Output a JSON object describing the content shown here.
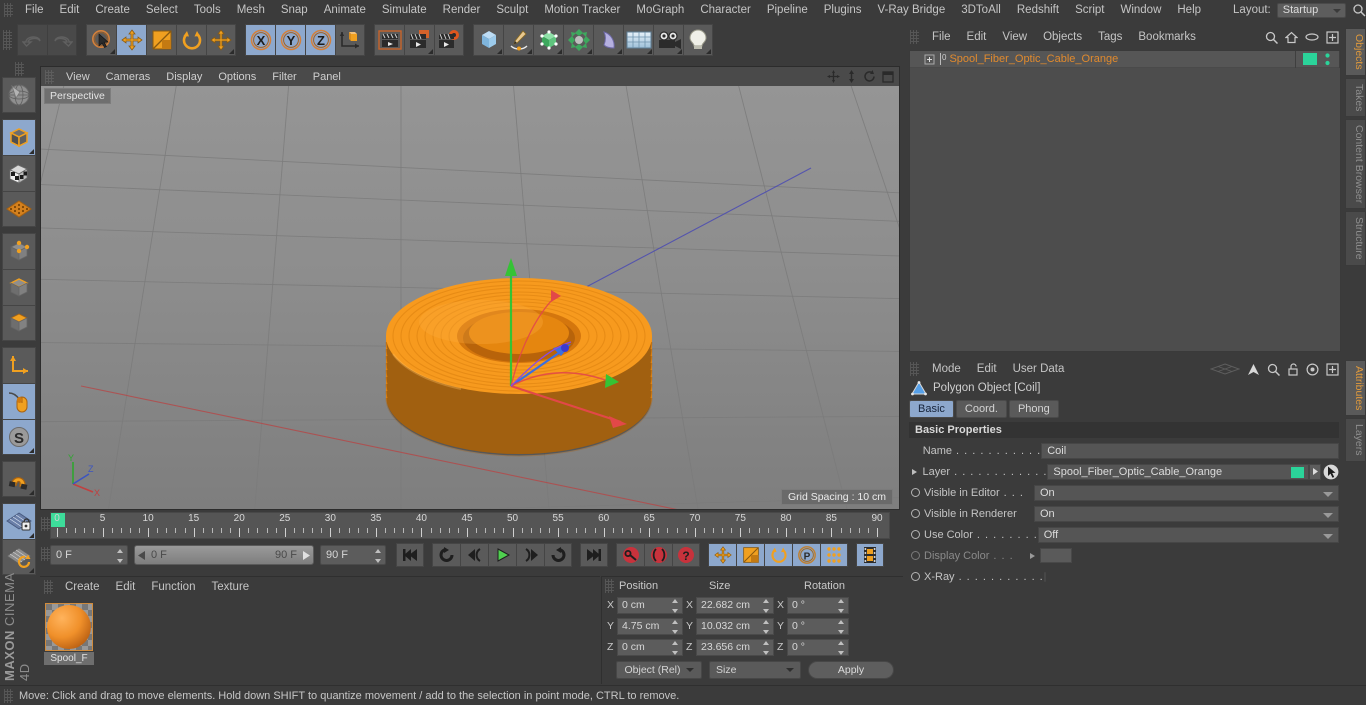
{
  "menubar": {
    "items": [
      "File",
      "Edit",
      "Create",
      "Select",
      "Tools",
      "Mesh",
      "Snap",
      "Animate",
      "Simulate",
      "Render",
      "Sculpt",
      "Motion Tracker",
      "MoGraph",
      "Character",
      "Pipeline",
      "Plugins",
      "V-Ray Bridge",
      "3DToAll",
      "Redshift",
      "Script",
      "Window",
      "Help"
    ],
    "layout_label": "Layout:",
    "layout_value": "Startup",
    "search_icon": "search-icon"
  },
  "toolbar": {
    "groups": [
      {
        "buttons": [
          {
            "name": "undo-button",
            "icon": "undo-icon",
            "state": "disabled"
          },
          {
            "name": "redo-button",
            "icon": "redo-icon",
            "state": "disabled"
          }
        ]
      },
      {
        "buttons": [
          {
            "name": "live-selection-tool",
            "icon": "cursor-circle-icon",
            "state": "normal"
          },
          {
            "name": "move-tool",
            "icon": "move-arrows-icon",
            "state": "active"
          },
          {
            "name": "scale-tool",
            "icon": "scale-box-icon",
            "state": "normal"
          },
          {
            "name": "rotate-tool",
            "icon": "rotate-arc-icon",
            "state": "normal"
          },
          {
            "name": "move-duplicate-tool",
            "icon": "move-arrows-icon",
            "state": "normal"
          }
        ]
      },
      {
        "buttons": [
          {
            "name": "lock-x-axis-button",
            "icon": "axis-x-icon",
            "state": "active"
          },
          {
            "name": "lock-y-axis-button",
            "icon": "axis-y-icon",
            "state": "active"
          },
          {
            "name": "lock-z-axis-button",
            "icon": "axis-z-icon",
            "state": "active"
          },
          {
            "name": "world-object-coordinates-button",
            "icon": "world-axis-cube-icon",
            "state": "normal"
          }
        ]
      },
      {
        "buttons": [
          {
            "name": "render-view-button",
            "icon": "clapperboard-icon",
            "state": "normal"
          },
          {
            "name": "render-region-button",
            "icon": "clapperboard-region-icon",
            "state": "normal"
          },
          {
            "name": "render-settings-button",
            "icon": "clapperboard-gear-icon",
            "state": "normal"
          }
        ]
      },
      {
        "buttons": [
          {
            "name": "primitive-cube-button",
            "icon": "cube-blue-icon",
            "state": "normal"
          },
          {
            "name": "spline-pen-button",
            "icon": "pen-spline-icon",
            "state": "normal"
          },
          {
            "name": "generator-button",
            "icon": "green-cube-icon",
            "state": "normal"
          },
          {
            "name": "deformer-button",
            "icon": "green-cluster-icon",
            "state": "normal"
          },
          {
            "name": "bend-deformer-button",
            "icon": "bend-shape-icon",
            "state": "normal"
          },
          {
            "name": "floor-environment-button",
            "icon": "floor-grid-icon",
            "state": "normal"
          },
          {
            "name": "camera-button",
            "icon": "camera-icon",
            "state": "normal"
          },
          {
            "name": "light-button",
            "icon": "lightbulb-icon",
            "state": "normal"
          }
        ]
      }
    ]
  },
  "leftbar": {
    "groups": [
      {
        "buttons": [
          {
            "name": "make-editable-button",
            "icon": "globe-wire-icon",
            "state": "normal"
          }
        ]
      },
      {
        "buttons": [
          {
            "name": "model-mode-button",
            "icon": "model-cube-icon",
            "state": "active"
          },
          {
            "name": "texture-mode-button",
            "icon": "texture-cube-icon",
            "state": "normal"
          },
          {
            "name": "uv-mesh-button",
            "icon": "uv-grid-icon",
            "state": "normal"
          }
        ]
      },
      {
        "buttons": [
          {
            "name": "points-mode-button",
            "icon": "points-cube-icon",
            "state": "normal"
          },
          {
            "name": "edges-mode-button",
            "icon": "edges-cube-icon",
            "state": "normal"
          },
          {
            "name": "polygons-mode-button",
            "icon": "polygons-cube-icon",
            "state": "normal"
          }
        ]
      },
      {
        "buttons": [
          {
            "name": "object-axis-button",
            "icon": "axis-corner-icon",
            "state": "normal"
          },
          {
            "name": "enable-axis-button",
            "icon": "mouse-axis-icon",
            "state": "active"
          },
          {
            "name": "enable-snapping-button",
            "icon": "snap-s-icon",
            "state": "active"
          }
        ]
      },
      {
        "buttons": [
          {
            "name": "magnet-tool-button",
            "icon": "magnet-icon",
            "state": "normal"
          }
        ]
      },
      {
        "buttons": [
          {
            "name": "workplane-lock-button",
            "icon": "workplane-lock-icon",
            "state": "active"
          },
          {
            "name": "workplane-rotate-button",
            "icon": "workplane-rotate-icon",
            "state": "normal"
          }
        ]
      }
    ],
    "brand_top": "MAXON",
    "brand_bottom": "CINEMA 4D"
  },
  "viewport": {
    "menu": [
      "View",
      "Cameras",
      "Display",
      "Options",
      "Filter",
      "Panel"
    ],
    "view_label": "Perspective",
    "grid_spacing": "Grid Spacing : 10 cm",
    "axis_labels": {
      "x": "X",
      "y": "Y",
      "z": "Z"
    },
    "right_icons": [
      "pan-icon",
      "axis-move-icon",
      "refresh-icon",
      "maximize-icon"
    ]
  },
  "timeline": {
    "ticks": [
      "0",
      "5",
      "10",
      "15",
      "20",
      "25",
      "30",
      "35",
      "40",
      "45",
      "50",
      "55",
      "60",
      "65",
      "70",
      "75",
      "80",
      "85",
      "90"
    ],
    "current_frame": "0 F",
    "range_start": "0 F",
    "range_end": "90 F",
    "max_frame": "90 F",
    "preview_frame": "0 F",
    "transport": [
      {
        "name": "goto-start-button",
        "icon": "skip-start-icon"
      },
      {
        "name": "play-backwards-loop-button",
        "icon": "loop-back-icon"
      },
      {
        "name": "step-back-button",
        "icon": "step-back-icon"
      },
      {
        "name": "play-button",
        "icon": "play-icon"
      },
      {
        "name": "step-forward-button",
        "icon": "step-forward-icon"
      },
      {
        "name": "play-forward-loop-button",
        "icon": "loop-forward-icon"
      },
      {
        "name": "goto-end-button",
        "icon": "skip-end-icon"
      }
    ],
    "keyframe_buttons": [
      {
        "name": "record-active-objects-button",
        "icon": "key-record-icon"
      },
      {
        "name": "autokeying-button",
        "icon": "autokey-icon"
      },
      {
        "name": "keyframe-selection-button",
        "icon": "key-question-icon"
      }
    ],
    "key_toggles": [
      {
        "name": "position-key-button",
        "icon": "move-arrows-icon",
        "state": "active"
      },
      {
        "name": "scale-key-button",
        "icon": "scale-box-icon",
        "state": "active"
      },
      {
        "name": "rotation-key-button",
        "icon": "rotate-arc-icon",
        "state": "active"
      },
      {
        "name": "parameter-key-button",
        "icon": "param-p-icon",
        "state": "active"
      },
      {
        "name": "point-level-animation-button",
        "icon": "pla-dots-icon",
        "state": "active"
      }
    ],
    "extra_button": {
      "name": "timeline-filmstrip-button",
      "icon": "filmstrip-icon",
      "state": "active"
    }
  },
  "material_manager": {
    "menu": [
      "Create",
      "Edit",
      "Function",
      "Texture"
    ],
    "materials": [
      {
        "name": "Spool_F"
      }
    ]
  },
  "coordinate_manager": {
    "headers": [
      "Position",
      "Size",
      "Rotation"
    ],
    "rows": [
      {
        "axis": "X",
        "position": "0 cm",
        "size": "22.682 cm",
        "rotation": "0 °"
      },
      {
        "axis": "Y",
        "position": "4.75 cm",
        "size": "10.032 cm",
        "rotation": "0 °"
      },
      {
        "axis": "Z",
        "position": "0 cm",
        "size": "23.656 cm",
        "rotation": "0 °"
      }
    ],
    "mode_dropdown": "Object (Rel)",
    "size_dropdown": "Size",
    "apply_label": "Apply"
  },
  "object_manager": {
    "menu": [
      "File",
      "Edit",
      "View",
      "Objects",
      "Tags",
      "Bookmarks"
    ],
    "right_icons": [
      "search-icon",
      "home-icon",
      "ellipse-icon",
      "plus-box-icon"
    ],
    "objects": [
      {
        "name": "Spool_Fiber_Optic_Cable_Orange",
        "layer_color": "#2bd49a",
        "level": "0"
      }
    ]
  },
  "attribute_manager": {
    "menu": [
      "Mode",
      "Edit",
      "User Data"
    ],
    "right_icons": [
      "plane-icon",
      "arrow-up-icon",
      "search-icon",
      "lock-icon",
      "target-icon",
      "plus-box-icon"
    ],
    "object_title": "Polygon Object [Coil]",
    "tabs": [
      {
        "label": "Basic",
        "active": true
      },
      {
        "label": "Coord.",
        "active": false
      },
      {
        "label": "Phong",
        "active": false
      }
    ],
    "section_title": "Basic Properties",
    "properties": [
      {
        "label": "Name",
        "dots": ". . . . . . . . . . .",
        "value": "Coil",
        "type": "text"
      },
      {
        "label": "Layer",
        "dots": ". . . . . . . . . . . .",
        "value": "Spool_Fiber_Optic_Cable_Orange",
        "type": "layer",
        "color": "#2bd49a"
      },
      {
        "label": "Visible in Editor",
        "dots": ". . .",
        "value": "On",
        "type": "dropdown"
      },
      {
        "label": "Visible in Renderer",
        "dots": "",
        "value": "On",
        "type": "dropdown"
      },
      {
        "label": "Use Color",
        "dots": ". . . . . . . .",
        "value": "Off",
        "type": "dropdown"
      },
      {
        "label": "Display Color",
        "dots": ". . .",
        "value": "",
        "type": "colorfield",
        "disabled": true
      },
      {
        "label": "X-Ray",
        "dots": ". . . . . . . . . . .",
        "value": "",
        "type": "checkbox"
      }
    ]
  },
  "right_tabs_top": [
    {
      "label": "Objects",
      "active": true
    },
    {
      "label": "Takes",
      "active": false
    },
    {
      "label": "Content Browser",
      "active": false
    },
    {
      "label": "Structure",
      "active": false
    }
  ],
  "right_tabs_bottom": [
    {
      "label": "Attributes",
      "active": true
    },
    {
      "label": "Layers",
      "active": false
    }
  ],
  "statusbar": {
    "message": "Move: Click and drag to move elements. Hold down SHIFT to quantize movement / add to the selection in point mode, CTRL to remove."
  },
  "colors": {
    "accent_orange": "#e08a2e",
    "active_blue": "#8da8cd",
    "layer_green": "#2bd49a",
    "model_orange": "#f08a1e",
    "panel_bg": "#3b3b3b",
    "viewport_bg": "#8a8a8a"
  }
}
